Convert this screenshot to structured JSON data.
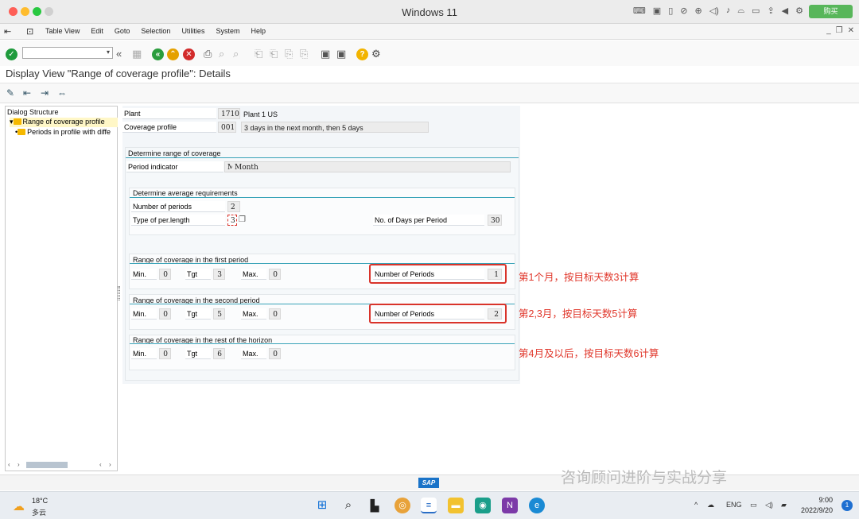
{
  "window": {
    "title": "Windows 11",
    "buy_label": "购买"
  },
  "menu": [
    "Table View",
    "Edit",
    "Goto",
    "Selection",
    "Utilities",
    "System",
    "Help"
  ],
  "page_title": "Display View \"Range of coverage profile\": Details",
  "dialog": {
    "heading": "Dialog Structure",
    "item1": "Range of coverage profile",
    "item2": "Periods in profile with diffe"
  },
  "header": {
    "plant_label": "Plant",
    "plant_value": "1710",
    "plant_desc": "Plant 1 US",
    "profile_label": "Coverage profile",
    "profile_value": "001",
    "profile_desc": "3 days in the next month, then 5 days"
  },
  "determine_range": {
    "title": "Determine range of coverage",
    "period_indicator_label": "Period indicator",
    "period_indicator_value": "M",
    "period_indicator_desc": "Month"
  },
  "avg_req": {
    "title": "Determine average requirements",
    "num_periods_label": "Number of periods",
    "num_periods_value": "2",
    "type_label": "Type of per.length",
    "type_value": "3",
    "days_label": "No. of Days per Period",
    "days_value": "30"
  },
  "first_period": {
    "title": "Range of coverage in the first period",
    "min_label": "Min.",
    "min": "0",
    "tgt_label": "Tgt",
    "tgt": "3",
    "max_label": "Max.",
    "max": "0",
    "periods_label": "Number of Periods",
    "periods": "1"
  },
  "second_period": {
    "title": "Range of coverage in the second period",
    "min_label": "Min.",
    "min": "0",
    "tgt_label": "Tgt",
    "tgt": "5",
    "max_label": "Max.",
    "max": "0",
    "periods_label": "Number of Periods",
    "periods": "2"
  },
  "rest_period": {
    "title": "Range of coverage in the rest of the horizon",
    "min_label": "Min.",
    "min": "0",
    "tgt_label": "Tgt",
    "tgt": "6",
    "max_label": "Max.",
    "max": "0"
  },
  "annotations": {
    "a1": "第1个月，按目标天数3计算",
    "a2": "第2,3月，按目标天数5计算",
    "a3": "第4月及以后，按目标天数6计算"
  },
  "status": {
    "sap": "SAP",
    "watermark": "咨询顾问进阶与实战分享"
  },
  "taskbar": {
    "temp": "18°C",
    "weather": "多云",
    "lang": "ENG",
    "time": "9:00",
    "date": "2022/9/20",
    "notifications": "1"
  },
  "colors": {
    "annotation": "#e0362a",
    "group_line": "#39a3b8",
    "selection": "#fff7c7"
  }
}
